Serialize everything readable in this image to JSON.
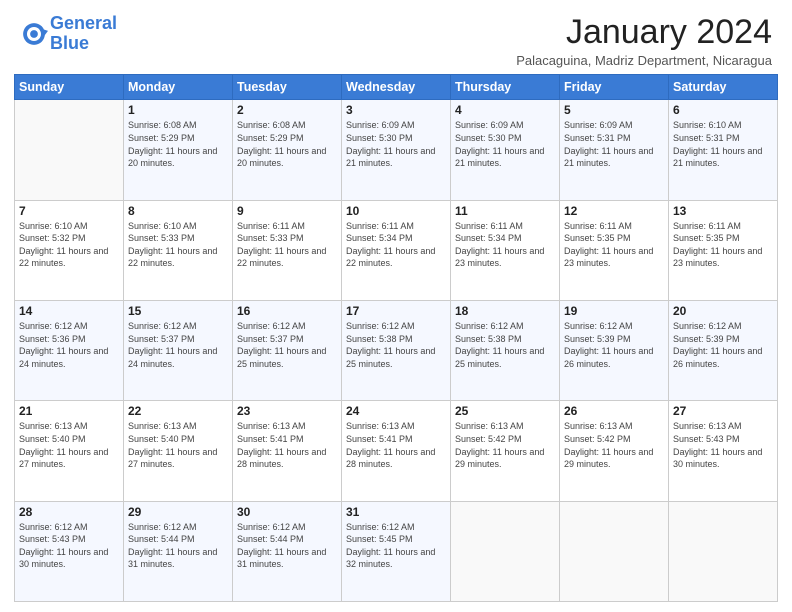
{
  "header": {
    "logo_text_general": "General",
    "logo_text_blue": "Blue",
    "month_title": "January 2024",
    "subtitle": "Palacaguina, Madriz Department, Nicaragua"
  },
  "calendar": {
    "days_of_week": [
      "Sunday",
      "Monday",
      "Tuesday",
      "Wednesday",
      "Thursday",
      "Friday",
      "Saturday"
    ],
    "weeks": [
      [
        {
          "day": "",
          "sunrise": "",
          "sunset": "",
          "daylight": ""
        },
        {
          "day": "1",
          "sunrise": "Sunrise: 6:08 AM",
          "sunset": "Sunset: 5:29 PM",
          "daylight": "Daylight: 11 hours and 20 minutes."
        },
        {
          "day": "2",
          "sunrise": "Sunrise: 6:08 AM",
          "sunset": "Sunset: 5:29 PM",
          "daylight": "Daylight: 11 hours and 20 minutes."
        },
        {
          "day": "3",
          "sunrise": "Sunrise: 6:09 AM",
          "sunset": "Sunset: 5:30 PM",
          "daylight": "Daylight: 11 hours and 21 minutes."
        },
        {
          "day": "4",
          "sunrise": "Sunrise: 6:09 AM",
          "sunset": "Sunset: 5:30 PM",
          "daylight": "Daylight: 11 hours and 21 minutes."
        },
        {
          "day": "5",
          "sunrise": "Sunrise: 6:09 AM",
          "sunset": "Sunset: 5:31 PM",
          "daylight": "Daylight: 11 hours and 21 minutes."
        },
        {
          "day": "6",
          "sunrise": "Sunrise: 6:10 AM",
          "sunset": "Sunset: 5:31 PM",
          "daylight": "Daylight: 11 hours and 21 minutes."
        }
      ],
      [
        {
          "day": "7",
          "sunrise": "Sunrise: 6:10 AM",
          "sunset": "Sunset: 5:32 PM",
          "daylight": "Daylight: 11 hours and 22 minutes."
        },
        {
          "day": "8",
          "sunrise": "Sunrise: 6:10 AM",
          "sunset": "Sunset: 5:33 PM",
          "daylight": "Daylight: 11 hours and 22 minutes."
        },
        {
          "day": "9",
          "sunrise": "Sunrise: 6:11 AM",
          "sunset": "Sunset: 5:33 PM",
          "daylight": "Daylight: 11 hours and 22 minutes."
        },
        {
          "day": "10",
          "sunrise": "Sunrise: 6:11 AM",
          "sunset": "Sunset: 5:34 PM",
          "daylight": "Daylight: 11 hours and 22 minutes."
        },
        {
          "day": "11",
          "sunrise": "Sunrise: 6:11 AM",
          "sunset": "Sunset: 5:34 PM",
          "daylight": "Daylight: 11 hours and 23 minutes."
        },
        {
          "day": "12",
          "sunrise": "Sunrise: 6:11 AM",
          "sunset": "Sunset: 5:35 PM",
          "daylight": "Daylight: 11 hours and 23 minutes."
        },
        {
          "day": "13",
          "sunrise": "Sunrise: 6:11 AM",
          "sunset": "Sunset: 5:35 PM",
          "daylight": "Daylight: 11 hours and 23 minutes."
        }
      ],
      [
        {
          "day": "14",
          "sunrise": "Sunrise: 6:12 AM",
          "sunset": "Sunset: 5:36 PM",
          "daylight": "Daylight: 11 hours and 24 minutes."
        },
        {
          "day": "15",
          "sunrise": "Sunrise: 6:12 AM",
          "sunset": "Sunset: 5:37 PM",
          "daylight": "Daylight: 11 hours and 24 minutes."
        },
        {
          "day": "16",
          "sunrise": "Sunrise: 6:12 AM",
          "sunset": "Sunset: 5:37 PM",
          "daylight": "Daylight: 11 hours and 25 minutes."
        },
        {
          "day": "17",
          "sunrise": "Sunrise: 6:12 AM",
          "sunset": "Sunset: 5:38 PM",
          "daylight": "Daylight: 11 hours and 25 minutes."
        },
        {
          "day": "18",
          "sunrise": "Sunrise: 6:12 AM",
          "sunset": "Sunset: 5:38 PM",
          "daylight": "Daylight: 11 hours and 25 minutes."
        },
        {
          "day": "19",
          "sunrise": "Sunrise: 6:12 AM",
          "sunset": "Sunset: 5:39 PM",
          "daylight": "Daylight: 11 hours and 26 minutes."
        },
        {
          "day": "20",
          "sunrise": "Sunrise: 6:12 AM",
          "sunset": "Sunset: 5:39 PM",
          "daylight": "Daylight: 11 hours and 26 minutes."
        }
      ],
      [
        {
          "day": "21",
          "sunrise": "Sunrise: 6:13 AM",
          "sunset": "Sunset: 5:40 PM",
          "daylight": "Daylight: 11 hours and 27 minutes."
        },
        {
          "day": "22",
          "sunrise": "Sunrise: 6:13 AM",
          "sunset": "Sunset: 5:40 PM",
          "daylight": "Daylight: 11 hours and 27 minutes."
        },
        {
          "day": "23",
          "sunrise": "Sunrise: 6:13 AM",
          "sunset": "Sunset: 5:41 PM",
          "daylight": "Daylight: 11 hours and 28 minutes."
        },
        {
          "day": "24",
          "sunrise": "Sunrise: 6:13 AM",
          "sunset": "Sunset: 5:41 PM",
          "daylight": "Daylight: 11 hours and 28 minutes."
        },
        {
          "day": "25",
          "sunrise": "Sunrise: 6:13 AM",
          "sunset": "Sunset: 5:42 PM",
          "daylight": "Daylight: 11 hours and 29 minutes."
        },
        {
          "day": "26",
          "sunrise": "Sunrise: 6:13 AM",
          "sunset": "Sunset: 5:42 PM",
          "daylight": "Daylight: 11 hours and 29 minutes."
        },
        {
          "day": "27",
          "sunrise": "Sunrise: 6:13 AM",
          "sunset": "Sunset: 5:43 PM",
          "daylight": "Daylight: 11 hours and 30 minutes."
        }
      ],
      [
        {
          "day": "28",
          "sunrise": "Sunrise: 6:12 AM",
          "sunset": "Sunset: 5:43 PM",
          "daylight": "Daylight: 11 hours and 30 minutes."
        },
        {
          "day": "29",
          "sunrise": "Sunrise: 6:12 AM",
          "sunset": "Sunset: 5:44 PM",
          "daylight": "Daylight: 11 hours and 31 minutes."
        },
        {
          "day": "30",
          "sunrise": "Sunrise: 6:12 AM",
          "sunset": "Sunset: 5:44 PM",
          "daylight": "Daylight: 11 hours and 31 minutes."
        },
        {
          "day": "31",
          "sunrise": "Sunrise: 6:12 AM",
          "sunset": "Sunset: 5:45 PM",
          "daylight": "Daylight: 11 hours and 32 minutes."
        },
        {
          "day": "",
          "sunrise": "",
          "sunset": "",
          "daylight": ""
        },
        {
          "day": "",
          "sunrise": "",
          "sunset": "",
          "daylight": ""
        },
        {
          "day": "",
          "sunrise": "",
          "sunset": "",
          "daylight": ""
        }
      ]
    ]
  }
}
